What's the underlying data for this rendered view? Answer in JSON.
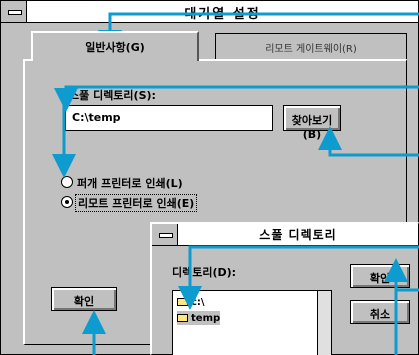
{
  "main_dialog": {
    "title": "대기열 설정",
    "tabs": [
      {
        "label": "일반사항(G)",
        "active": true
      },
      {
        "label": "리모트 게이트웨이(R)",
        "active": false
      }
    ],
    "spool_dir_label": "스풀 디렉토리(S):",
    "spool_dir_value": "C:\\temp",
    "browse_button": "찾아보기(B)",
    "radio_options": [
      {
        "label": "퍼개 프린터로 인쇄(L)",
        "selected": false
      },
      {
        "label": "리모트 프린터로 인쇄(E)",
        "selected": true
      }
    ],
    "ok_button": "확인"
  },
  "sub_dialog": {
    "title": "스풀 디렉토리",
    "directory_label": "디렉토리(D):",
    "list_items": [
      {
        "label": "c:\\",
        "selected": false
      },
      {
        "label": "temp",
        "selected": true
      }
    ],
    "ok_button": "확인",
    "cancel_button": "취소"
  },
  "colors": {
    "callout": "#0d9bd0",
    "dialog_face": "#c0c0c0"
  }
}
